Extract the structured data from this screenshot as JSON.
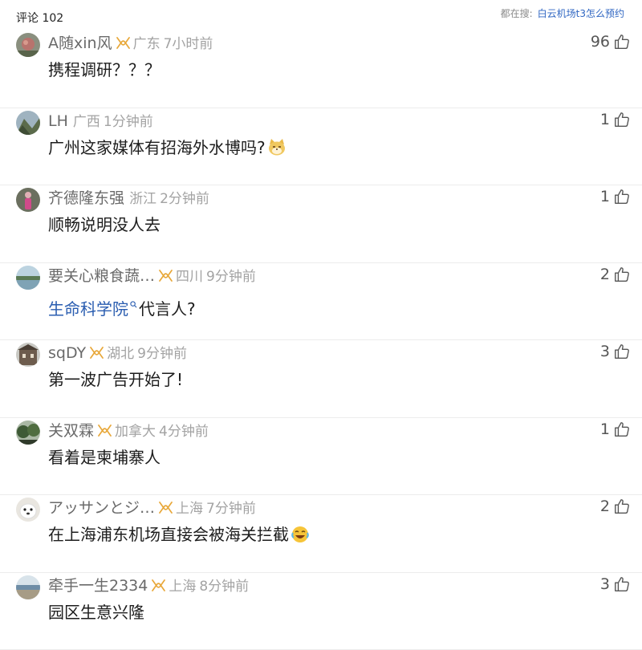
{
  "header": {
    "comment_count": "评论 102",
    "trending_label": "都在搜:",
    "trending_query": "白云机场t3怎么预约"
  },
  "comments": [
    {
      "name": "A随xin风",
      "badge": true,
      "location": "广东",
      "time": "7小时前",
      "text": "携程调研？？？",
      "likes": "96",
      "avatar": "avatar-rose"
    },
    {
      "name": "LH",
      "badge": false,
      "location": "广西",
      "time": "1分钟前",
      "text": "广州这家媒体有招海外水博吗?",
      "emoji": "cat",
      "likes": "1",
      "avatar": "avatar-mountain"
    },
    {
      "name": "齐德隆东强",
      "badge": false,
      "location": "浙江",
      "time": "2分钟前",
      "text": "顺畅说明没人去",
      "likes": "1",
      "avatar": "avatar-person"
    },
    {
      "name": "要关心粮食蔬…",
      "badge": true,
      "location": "四川",
      "time": "9分钟前",
      "text_link": "生命科学院",
      "text": "代言人?",
      "likes": "2",
      "avatar": "avatar-lake"
    },
    {
      "name": "sqDY",
      "badge": true,
      "location": "湖北",
      "time": "9分钟前",
      "text": "第一波广告开始了!",
      "likes": "3",
      "avatar": "avatar-building"
    },
    {
      "name": "关双霖",
      "badge": true,
      "location": "加拿大",
      "time": "4分钟前",
      "text": "看着是柬埔寨人",
      "likes": "1",
      "avatar": "avatar-forest"
    },
    {
      "name": "アッサンとジ…",
      "badge": true,
      "location": "上海",
      "time": "7分钟前",
      "text": "在上海浦东机场直接会被海关拦截",
      "emoji": "laugh",
      "likes": "2",
      "avatar": "avatar-dog"
    },
    {
      "name": "牵手一生2334",
      "badge": true,
      "location": "上海",
      "time": "8分钟前",
      "text": "园区生意兴隆",
      "likes": "3",
      "avatar": "avatar-beach"
    }
  ],
  "colors": {
    "link": "#2a5db0",
    "badge": "#e8a83a",
    "meta": "#a3a3a3"
  }
}
